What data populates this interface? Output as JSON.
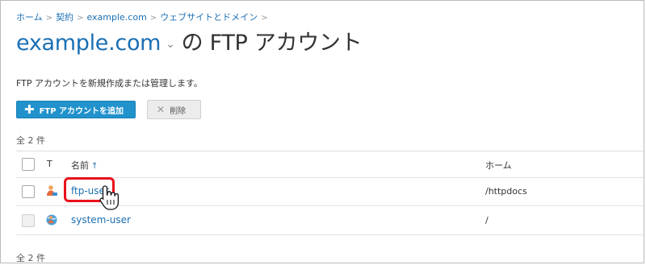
{
  "breadcrumb": {
    "items": [
      "ホーム",
      "契約",
      "example.com",
      "ウェブサイトとドメイン"
    ],
    "separator": ">"
  },
  "title": {
    "domain": "example.com",
    "suffix": "の FTP アカウント"
  },
  "hint": "FTP アカウントを新規作成または管理します。",
  "toolbar": {
    "add_label": "FTP アカウントを追加",
    "delete_label": "削除"
  },
  "list": {
    "total_top": "全 2 件",
    "total_bottom": "全 2 件",
    "columns": {
      "type": "T",
      "name": "名前",
      "sort_indicator": "↑",
      "home": "ホーム"
    },
    "rows": [
      {
        "name": "ftp-user",
        "home": "/httpdocs",
        "icon": "ftp-user-icon"
      },
      {
        "name": "system-user",
        "home": "/",
        "icon": "system-user-icon"
      }
    ]
  },
  "colors": {
    "link": "#1b6fb3",
    "button_primary": "#2192cc",
    "highlight": "#e8111a"
  }
}
